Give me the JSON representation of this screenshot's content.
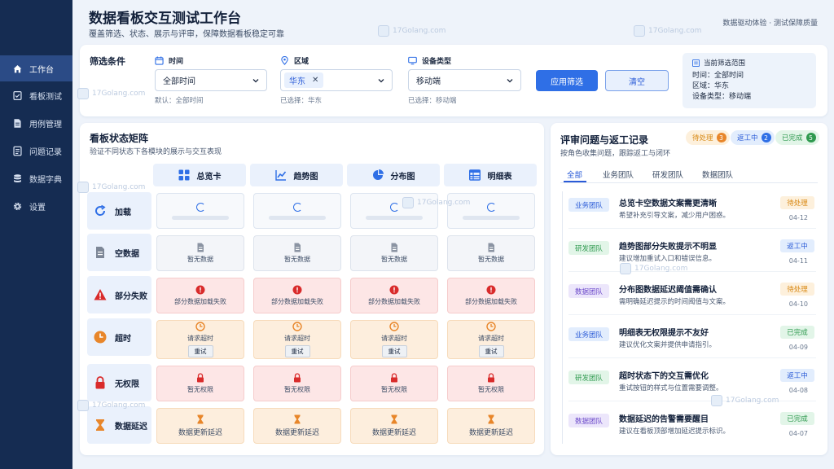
{
  "sidebar": {
    "items": [
      {
        "label": "工作台",
        "icon": "home-icon"
      },
      {
        "label": "看板测试",
        "icon": "check-doc-icon"
      },
      {
        "label": "用例管理",
        "icon": "doc-icon"
      },
      {
        "label": "问题记录",
        "icon": "record-icon"
      },
      {
        "label": "数据字典",
        "icon": "database-icon"
      },
      {
        "label": "设置",
        "icon": "gear-icon"
      }
    ]
  },
  "header": {
    "title": "数据看板交互测试工作台",
    "subtitle": "覆盖筛选、状态、展示与评审，保障数据看板稳定可靠",
    "right_text": "数据驱动体验 · 测试保障质量"
  },
  "watermark": "17Golang.com",
  "filters": {
    "title": "筛选条件",
    "time": {
      "label": "时间",
      "value": "全部时间",
      "hint": "默认：全部时间"
    },
    "region": {
      "label": "区域",
      "chip": "华东",
      "hint": "已选择：华东"
    },
    "device": {
      "label": "设备类型",
      "value": "移动端",
      "hint": "已选择：移动端"
    },
    "apply_label": "应用筛选",
    "clear_label": "清空",
    "summary": {
      "title": "当前筛选范围",
      "lines": [
        "时间：全部时间",
        "区域：华东",
        "设备类型：移动端"
      ]
    }
  },
  "matrix": {
    "title": "看板状态矩阵",
    "subtitle": "验证不同状态下各模块的展示与交互表现",
    "columns": [
      "总览卡",
      "趋势图",
      "分布图",
      "明细表"
    ],
    "rows": [
      "加载",
      "空数据",
      "部分失败",
      "超时",
      "无权限",
      "数据延迟"
    ],
    "empty_text": "暂无数据",
    "fail_text": "部分数据加载失败",
    "timeout_text": "请求超时",
    "retry_label": "重试",
    "denied_text": "暂无权限",
    "delay_text": "数据更新延迟"
  },
  "review": {
    "title": "评审问题与返工记录",
    "subtitle": "按角色收集问题，跟踪返工与闭环",
    "badges": [
      {
        "label": "待处理",
        "count": "3",
        "color": "#e8862a"
      },
      {
        "label": "返工中",
        "count": "2",
        "color": "#2f6fe6"
      },
      {
        "label": "已完成",
        "count": "5",
        "color": "#2f9a4f"
      }
    ],
    "tabs": [
      "全部",
      "业务团队",
      "研发团队",
      "数据团队"
    ],
    "items": [
      {
        "team": "业务团队",
        "title": "总览卡空数据文案需更清晰",
        "desc": "希望补充引导文案，减少用户困惑。",
        "status": "待处理",
        "date": "04-12"
      },
      {
        "team": "研发团队",
        "title": "趋势图部分失败提示不明显",
        "desc": "建议增加重试入口和错误信息。",
        "status": "返工中",
        "date": "04-11"
      },
      {
        "team": "数据团队",
        "title": "分布图数据延迟阈值需确认",
        "desc": "需明确延迟提示的时间阈值与文案。",
        "status": "待处理",
        "date": "04-10"
      },
      {
        "team": "业务团队",
        "title": "明细表无权限提示不友好",
        "desc": "建议优化文案并提供申请指引。",
        "status": "已完成",
        "date": "04-09"
      },
      {
        "team": "研发团队",
        "title": "超时状态下的交互需优化",
        "desc": "重试按钮的样式与位置需要调整。",
        "status": "返工中",
        "date": "04-08"
      },
      {
        "team": "数据团队",
        "title": "数据延迟的告警需要醒目",
        "desc": "建议在看板顶部增加延迟提示标识。",
        "status": "已完成",
        "date": "04-07"
      }
    ]
  }
}
